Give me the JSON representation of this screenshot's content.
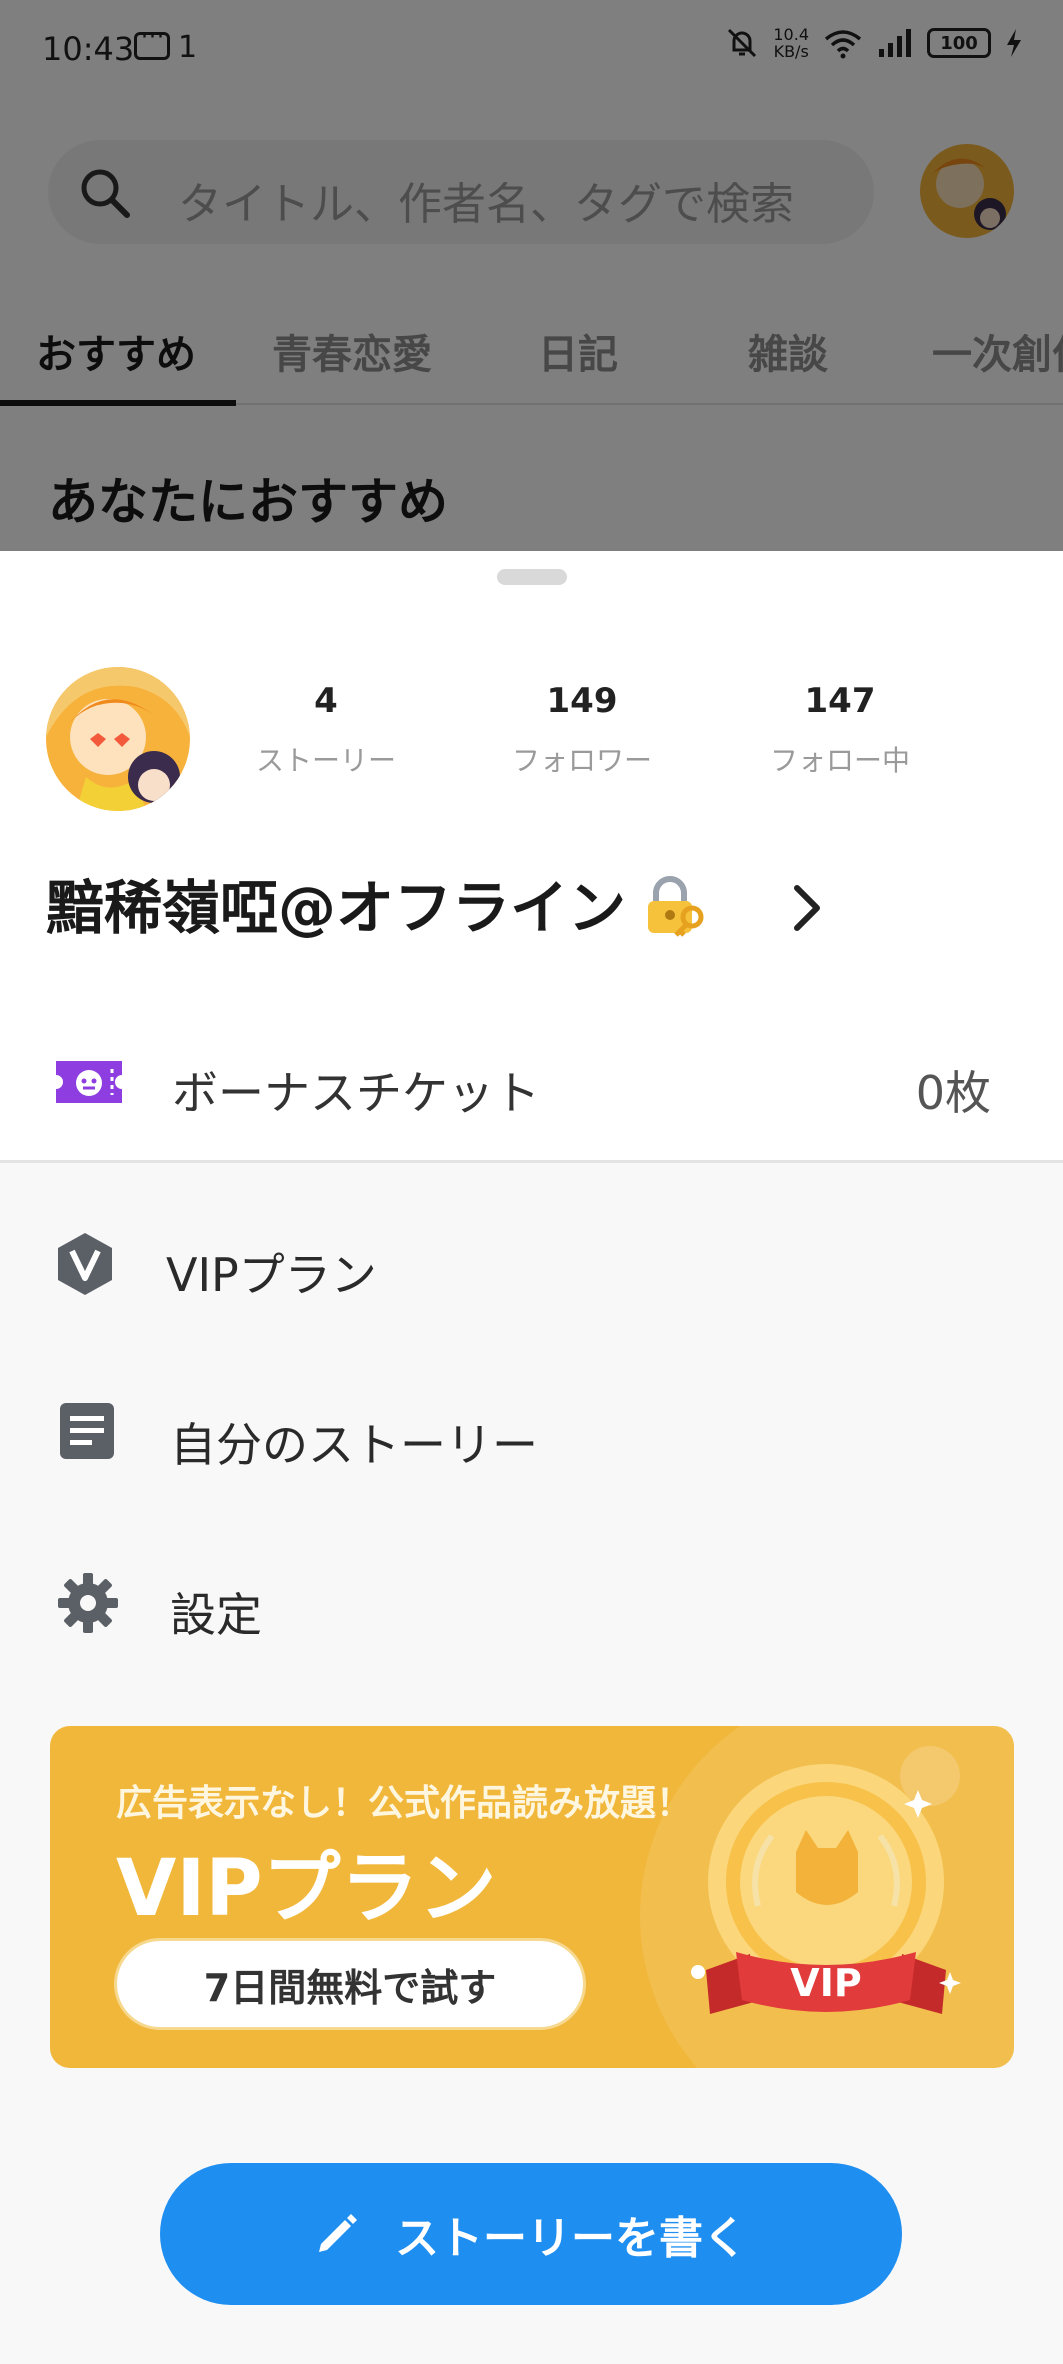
{
  "status_bar": {
    "time": "10:43",
    "notif_count": "1",
    "speed_value": "10.4",
    "speed_unit": "KB/s",
    "battery": "100"
  },
  "search": {
    "placeholder": "タイトル、作者名、タグで検索"
  },
  "tabs": [
    {
      "label": "おすすめ",
      "active": true
    },
    {
      "label": "青春恋愛",
      "active": false
    },
    {
      "label": "日記",
      "active": false
    },
    {
      "label": "雑談",
      "active": false
    },
    {
      "label": "一次創作",
      "active": false
    }
  ],
  "section_title": "あなたにおすすめ",
  "profile": {
    "stats": [
      {
        "value": "4",
        "label": "ストーリー"
      },
      {
        "value": "149",
        "label": "フォロワー"
      },
      {
        "value": "147",
        "label": "フォロー中"
      }
    ],
    "username": "黯稀嶺啞@オフライン"
  },
  "ticket": {
    "label": "ボーナスチケット",
    "value": "0枚"
  },
  "menu": [
    {
      "label": "VIPプラン",
      "icon": "vip-badge-icon"
    },
    {
      "label": "自分のストーリー",
      "icon": "document-icon"
    },
    {
      "label": "設定",
      "icon": "gear-icon"
    }
  ],
  "vip_banner": {
    "subtitle": "広告表示なし！公式作品読み放題！",
    "title": "VIPプラン",
    "cta": "7日間無料で試す",
    "medal_text": "VIP"
  },
  "write_button": {
    "label": "ストーリーを書く"
  },
  "colors": {
    "accent_blue": "#1f8ef1",
    "vip_gold": "#f1b73a",
    "ticket_purple": "#8e3ee0"
  }
}
